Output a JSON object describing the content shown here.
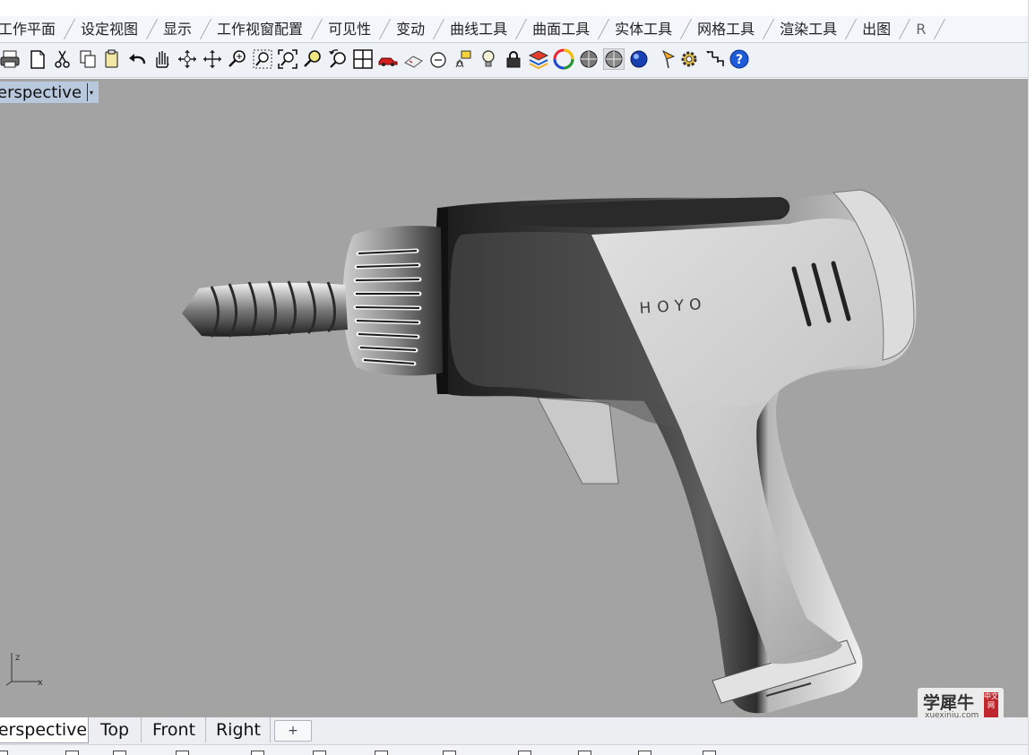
{
  "menu_tabs": [
    "工作平面",
    "设定视图",
    "显示",
    "工作视窗配置",
    "可见性",
    "变动",
    "曲线工具",
    "曲面工具",
    "实体工具",
    "网格工具",
    "渲染工具",
    "出图",
    "R"
  ],
  "toolbar_icons": [
    "print-icon",
    "new-file-icon",
    "cut-icon",
    "copy-icon",
    "paste-icon",
    "undo-icon",
    "pan-hand-icon",
    "rotate-view-icon",
    "rotate-view-2-icon",
    "zoom-dynamic-icon",
    "zoom-window-icon",
    "zoom-extents-icon",
    "zoom-selected-icon",
    "undo-view-icon",
    "four-view-icon",
    "car-icon",
    "camera-icon",
    "circle-dim-icon",
    "snap-icon",
    "light-icon",
    "lock-icon",
    "layers-icon",
    "color-wheel-icon",
    "sphere-grey-icon",
    "sphere-shaded-icon",
    "sphere-blue-icon",
    "properties-icon",
    "options-gear-icon",
    "grid-snap-icon",
    "help-icon"
  ],
  "viewport": {
    "title": "Perspective",
    "title_visible": "erspective",
    "brand_text": "HOYO",
    "axis_z": "z",
    "axis_x": "x"
  },
  "watermark": {
    "cn": "学犀牛",
    "en": "xuexiniu.com",
    "seal": "中文网"
  },
  "view_tabs": [
    {
      "label": "erspective",
      "active": true
    },
    {
      "label": "Top",
      "active": false
    },
    {
      "label": "Front",
      "active": false
    },
    {
      "label": "Right",
      "active": false
    },
    {
      "label": "+",
      "active": false
    }
  ],
  "colors": {
    "viewport_bg": "#a3a3a3",
    "title_bg": "#b9c9dd",
    "help_blue": "#1e5bd6"
  }
}
